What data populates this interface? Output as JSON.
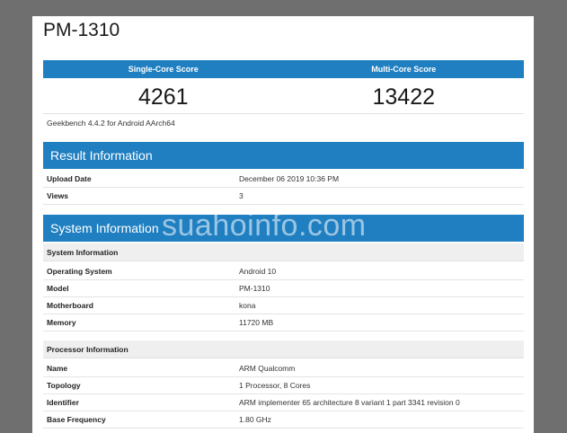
{
  "device_title": "PM-1310",
  "scores": {
    "single_label": "Single-Core Score",
    "multi_label": "Multi-Core Score",
    "single_value": "4261",
    "multi_value": "13422"
  },
  "version_note": "Geekbench 4.4.2 for Android AArch64",
  "result_info": {
    "header": "Result Information",
    "rows": [
      {
        "key": "Upload Date",
        "value": "December 06 2019 10:36 PM"
      },
      {
        "key": "Views",
        "value": "3"
      }
    ]
  },
  "system_info": {
    "header": "System Information",
    "subhead_system": "System Information",
    "system_rows": [
      {
        "key": "Operating System",
        "value": "Android 10"
      },
      {
        "key": "Model",
        "value": "PM-1310"
      },
      {
        "key": "Motherboard",
        "value": "kona"
      },
      {
        "key": "Memory",
        "value": "11720 MB"
      }
    ],
    "subhead_processor": "Processor Information",
    "processor_rows": [
      {
        "key": "Name",
        "value": "ARM Qualcomm"
      },
      {
        "key": "Topology",
        "value": "1 Processor, 8 Cores"
      },
      {
        "key": "Identifier",
        "value": "ARM implementer 65 architecture 8 variant 1 part 3341 revision 0"
      },
      {
        "key": "Base Frequency",
        "value": "1.80 GHz"
      }
    ]
  },
  "watermark": "suahoinfo.com",
  "colors": {
    "accent": "#1f7fc1",
    "backdrop": "#6f6f6f"
  }
}
